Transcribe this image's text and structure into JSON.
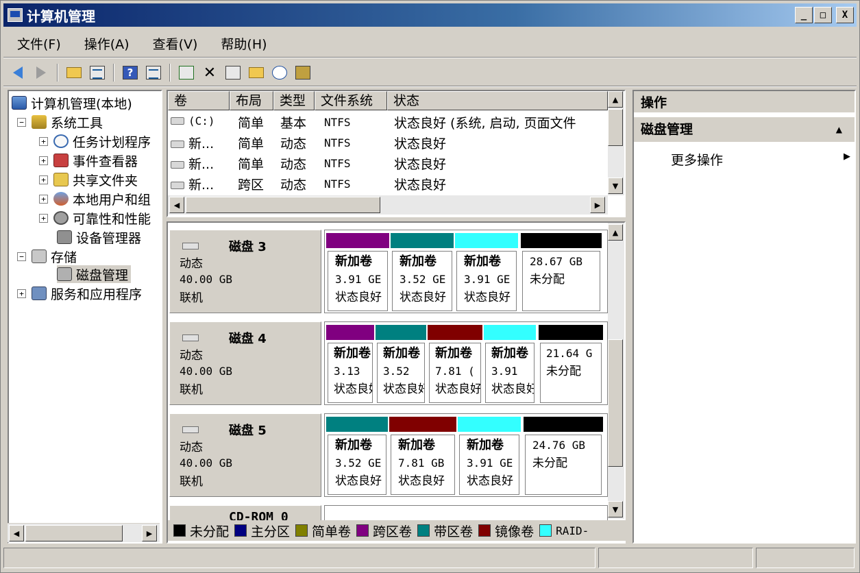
{
  "window": {
    "title": "计算机管理"
  },
  "window_buttons": {
    "minimize": "_",
    "maximize": "□",
    "close": "X"
  },
  "menu": {
    "items": [
      "文件(F)",
      "操作(A)",
      "查看(V)",
      "帮助(H)"
    ]
  },
  "toolbar": {
    "icons": [
      "back-arrow",
      "forward-arrow",
      "up-folder",
      "show-hide-tree",
      "help",
      "show-hide-action",
      "refresh",
      "delete",
      "properties",
      "open-folder",
      "search",
      "export"
    ],
    "help_glyph": "?",
    "delete_glyph": "✕"
  },
  "tree": {
    "root": "计算机管理(本地)",
    "items": [
      {
        "label": "系统工具",
        "expander": "−"
      },
      {
        "label": "任务计划程序",
        "expander": "+"
      },
      {
        "label": "事件查看器",
        "expander": "+"
      },
      {
        "label": "共享文件夹",
        "expander": "+"
      },
      {
        "label": "本地用户和组",
        "expander": "+"
      },
      {
        "label": "可靠性和性能",
        "expander": "+"
      },
      {
        "label": "设备管理器"
      },
      {
        "label": "存储",
        "expander": "−"
      },
      {
        "label": "磁盘管理"
      },
      {
        "label": "服务和应用程序",
        "expander": "+"
      }
    ]
  },
  "volume_list": {
    "columns": [
      "卷",
      "布局",
      "类型",
      "文件系统",
      "状态"
    ],
    "rows": [
      {
        "volume": "(C:)",
        "layout": "简单",
        "type": "基本",
        "fs": "NTFS",
        "status": "状态良好 (系统, 启动, 页面文件"
      },
      {
        "volume": "新...",
        "layout": "简单",
        "type": "动态",
        "fs": "NTFS",
        "status": "状态良好"
      },
      {
        "volume": "新...",
        "layout": "简单",
        "type": "动态",
        "fs": "NTFS",
        "status": "状态良好"
      },
      {
        "volume": "新...",
        "layout": "跨区",
        "type": "动态",
        "fs": "NTFS",
        "status": "状态良好"
      }
    ]
  },
  "disks": [
    {
      "name": "磁盘 3",
      "type": "动态",
      "size": "40.00 GB",
      "state": "联机",
      "partitions": [
        {
          "name": "新加卷",
          "size": "3.91 GE",
          "status": "状态良好",
          "color": "#800080"
        },
        {
          "name": "新加卷",
          "size": "3.52 GE",
          "status": "状态良好",
          "color": "#008080"
        },
        {
          "name": "新加卷",
          "size": "3.91 GE",
          "status": "状态良好",
          "color": "#33ffff"
        },
        {
          "name": "",
          "size": "28.67 GB",
          "status": "未分配",
          "color": "#000000"
        }
      ]
    },
    {
      "name": "磁盘 4",
      "type": "动态",
      "size": "40.00 GB",
      "state": "联机",
      "partitions": [
        {
          "name": "新加卷",
          "size": "3.13",
          "status": "状态良好",
          "color": "#800080"
        },
        {
          "name": "新加卷",
          "size": "3.52",
          "status": "状态良好",
          "color": "#008080"
        },
        {
          "name": "新加卷",
          "size": "7.81 (",
          "status": "状态良好",
          "color": "#800000"
        },
        {
          "name": "新加卷",
          "size": "3.91",
          "status": "状态良好",
          "color": "#33ffff"
        },
        {
          "name": "",
          "size": "21.64 G",
          "status": "未分配",
          "color": "#000000"
        }
      ]
    },
    {
      "name": "磁盘 5",
      "type": "动态",
      "size": "40.00 GB",
      "state": "联机",
      "partitions": [
        {
          "name": "新加卷",
          "size": "3.52 GE",
          "status": "状态良好",
          "color": "#008080"
        },
        {
          "name": "新加卷",
          "size": "7.81 GB",
          "status": "状态良好",
          "color": "#800000"
        },
        {
          "name": "新加卷",
          "size": "3.91 GE",
          "status": "状态良好",
          "color": "#33ffff"
        },
        {
          "name": "",
          "size": "24.76 GB",
          "status": "未分配",
          "color": "#000000"
        }
      ]
    },
    {
      "name": "CD-ROM 0"
    }
  ],
  "legend": [
    {
      "label": "未分配",
      "color": "#000000"
    },
    {
      "label": "主分区",
      "color": "#000080"
    },
    {
      "label": "简单卷",
      "color": "#808000"
    },
    {
      "label": "跨区卷",
      "color": "#800080"
    },
    {
      "label": "带区卷",
      "color": "#008080"
    },
    {
      "label": "镜像卷",
      "color": "#800000"
    },
    {
      "label": "RAID-",
      "color": "#33ffff"
    }
  ],
  "actions": {
    "header": "操作",
    "section": "磁盘管理",
    "section_arrow": "▲",
    "more": "更多操作",
    "more_arrow": "▶"
  },
  "scroll_glyphs": {
    "up": "▲",
    "down": "▼",
    "left": "◀",
    "right": "▶"
  }
}
